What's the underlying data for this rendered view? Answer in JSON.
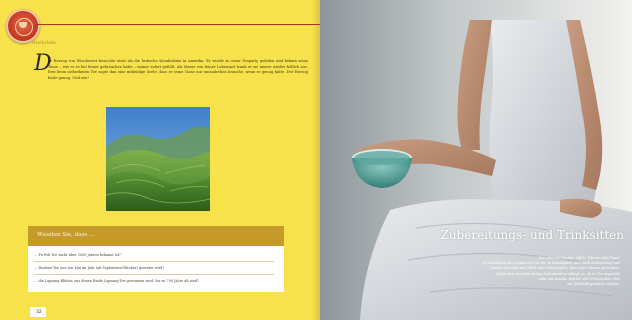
{
  "left_page": {
    "section_label": "Anekdote",
    "dropcap": "D",
    "body": "er Herzog von Winchester besuchte einst als die britische Kronkolonie in Amerika. Er wurde zu einer Teeparty geladen und bekam seine Tasse – wie er es bei feiner gebrauchen hatte – immer sofort gefüllt. Als Masse von feiner Lebensart trank er sie immer wieder höflich aus. Erst beim siebzehnten Tee sagte ihm eine mitleidige Seele, dass er seine Tasse nur umzudrehen brauche, wenn er genug hätte. Der Herzog hatte genug. Und wie!",
    "facts_title": "Wussten Sie, dass …",
    "facts": [
      "… Pu-Erh-Tee mehr über 3000 Jahren bekannt ist?",
      "… Rooibos-Tee nur von Mai im Jahr (ab September/Oktober) geerntet wird?",
      "… die Lapsang-Blätter, aus denen Rinde Lapsang-Tee gewonnen wird, bis zu 700 Jahre alt sind?"
    ],
    "page_number": "32"
  },
  "right_page": {
    "heading": "Zubereitungs- und Trinksitten",
    "text_lines": [
      "Pur oder mit Zucker, Milch, Zitrone oder Rum?",
      "Je vielfältiger das Aroma von Tee ist, so mannigfach sind auch Zubereitung und",
      "Genuss.Tee wird mit Milch oder Schlagobers, Rum oder Zitrone getrunken.",
      "Allein dem Geschmack des Konsumenten obliegt es, ob er Tee ungesüßt",
      "oder mit Kandis, Würfel- oder Rohrzucker oder",
      "mit Süßstoff genießen möchte."
    ]
  },
  "colors": {
    "page_yellow": "#f7e24b",
    "gold_header": "#c69a2a",
    "rule_red": "#b23124",
    "logo_red": "#c63a24"
  },
  "icons": {
    "logo": "tea-emblem-icon"
  }
}
